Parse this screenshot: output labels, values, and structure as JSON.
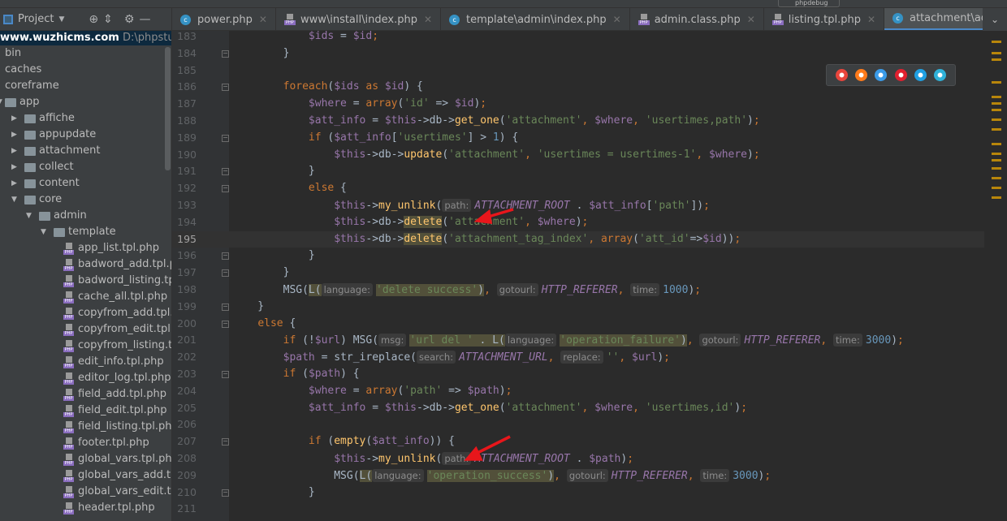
{
  "toolbar": {
    "run_config": "phpdebug"
  },
  "sidebar": {
    "title": "Project",
    "project_name": "www.wuzhicms.com",
    "project_path": "D:\\phpstudy_pro",
    "items": [
      {
        "label": "bin",
        "level": 0,
        "type": "folder",
        "arrow": ""
      },
      {
        "label": "caches",
        "level": 0,
        "type": "folder",
        "arrow": ""
      },
      {
        "label": "coreframe",
        "level": 0,
        "type": "folder",
        "arrow": ""
      },
      {
        "label": "app",
        "level": 0,
        "type": "folder",
        "arrow": "open"
      },
      {
        "label": "affiche",
        "level": 1,
        "type": "folder",
        "arrow": "closed"
      },
      {
        "label": "appupdate",
        "level": 1,
        "type": "folder",
        "arrow": "closed"
      },
      {
        "label": "attachment",
        "level": 1,
        "type": "folder",
        "arrow": "closed"
      },
      {
        "label": "collect",
        "level": 1,
        "type": "folder",
        "arrow": "closed"
      },
      {
        "label": "content",
        "level": 1,
        "type": "folder",
        "arrow": "closed"
      },
      {
        "label": "core",
        "level": 1,
        "type": "folder",
        "arrow": "open"
      },
      {
        "label": "admin",
        "level": 2,
        "type": "folder",
        "arrow": "open"
      },
      {
        "label": "template",
        "level": 3,
        "type": "folder",
        "arrow": "open"
      },
      {
        "label": "app_list.tpl.php",
        "level": 4,
        "type": "file"
      },
      {
        "label": "badword_add.tpl.php",
        "level": 4,
        "type": "file"
      },
      {
        "label": "badword_listing.tpl.php",
        "level": 4,
        "type": "file"
      },
      {
        "label": "cache_all.tpl.php",
        "level": 4,
        "type": "file"
      },
      {
        "label": "copyfrom_add.tpl.php",
        "level": 4,
        "type": "file"
      },
      {
        "label": "copyfrom_edit.tpl.php",
        "level": 4,
        "type": "file"
      },
      {
        "label": "copyfrom_listing.tpl.php",
        "level": 4,
        "type": "file"
      },
      {
        "label": "edit_info.tpl.php",
        "level": 4,
        "type": "file"
      },
      {
        "label": "editor_log.tpl.php",
        "level": 4,
        "type": "file"
      },
      {
        "label": "field_add.tpl.php",
        "level": 4,
        "type": "file"
      },
      {
        "label": "field_edit.tpl.php",
        "level": 4,
        "type": "file"
      },
      {
        "label": "field_listing.tpl.php",
        "level": 4,
        "type": "file"
      },
      {
        "label": "footer.tpl.php",
        "level": 4,
        "type": "file"
      },
      {
        "label": "global_vars.tpl.php",
        "level": 4,
        "type": "file"
      },
      {
        "label": "global_vars_add.tpl.php",
        "level": 4,
        "type": "file"
      },
      {
        "label": "global_vars_edit.tpl.php",
        "level": 4,
        "type": "file"
      },
      {
        "label": "header.tpl.php",
        "level": 4,
        "type": "file"
      }
    ]
  },
  "tabs": [
    {
      "label": "power.php",
      "icon": "class",
      "active": false
    },
    {
      "label": "www\\install\\index.php",
      "icon": "php",
      "active": false
    },
    {
      "label": "template\\admin\\index.php",
      "icon": "class",
      "active": false
    },
    {
      "label": "admin.class.php",
      "icon": "php",
      "active": false
    },
    {
      "label": "listing.tpl.php",
      "icon": "php",
      "active": false
    },
    {
      "label": "attachment\\admin\\index.php",
      "icon": "class",
      "active": true
    }
  ],
  "browsers": [
    {
      "name": "chrome",
      "color": "#e8453c"
    },
    {
      "name": "firefox",
      "color": "#ff7a1a"
    },
    {
      "name": "safari",
      "color": "#3a9be8"
    },
    {
      "name": "opera",
      "color": "#e0202f"
    },
    {
      "name": "ie",
      "color": "#1fa0e3"
    },
    {
      "name": "edge",
      "color": "#2fb1d8"
    }
  ],
  "editor": {
    "current_line": 195,
    "lines": [
      {
        "n": 183,
        "t": [
          [
            "d",
            "            "
          ],
          [
            "v",
            "$ids"
          ],
          [
            "d",
            " = "
          ],
          [
            "v",
            "$id"
          ],
          [
            "k",
            ";"
          ]
        ]
      },
      {
        "n": 184,
        "fold": true,
        "t": [
          [
            "d",
            "        }"
          ]
        ]
      },
      {
        "n": 185,
        "t": []
      },
      {
        "n": 186,
        "fold": true,
        "t": [
          [
            "d",
            "        "
          ],
          [
            "k",
            "foreach"
          ],
          [
            "d",
            "("
          ],
          [
            "v",
            "$ids"
          ],
          [
            "k",
            " as "
          ],
          [
            "v",
            "$id"
          ],
          [
            "d",
            ") {"
          ]
        ]
      },
      {
        "n": 187,
        "t": [
          [
            "d",
            "            "
          ],
          [
            "v",
            "$where"
          ],
          [
            "d",
            " = "
          ],
          [
            "k",
            "array"
          ],
          [
            "d",
            "("
          ],
          [
            "s",
            "'id'"
          ],
          [
            "d",
            " => "
          ],
          [
            "v",
            "$id"
          ],
          [
            "d",
            ")"
          ],
          [
            "k",
            ";"
          ]
        ]
      },
      {
        "n": 188,
        "t": [
          [
            "d",
            "            "
          ],
          [
            "v",
            "$att_info"
          ],
          [
            "d",
            " = "
          ],
          [
            "v",
            "$this"
          ],
          [
            "d",
            "->db->"
          ],
          [
            "f",
            "get_one"
          ],
          [
            "d",
            "("
          ],
          [
            "s",
            "'attachment'"
          ],
          [
            "k",
            ", "
          ],
          [
            "v",
            "$where"
          ],
          [
            "k",
            ", "
          ],
          [
            "s",
            "'usertimes,path'"
          ],
          [
            "d",
            ")"
          ],
          [
            "k",
            ";"
          ]
        ]
      },
      {
        "n": 189,
        "fold": true,
        "t": [
          [
            "d",
            "            "
          ],
          [
            "k",
            "if"
          ],
          [
            "d",
            " ("
          ],
          [
            "v",
            "$att_info"
          ],
          [
            "d",
            "["
          ],
          [
            "s",
            "'usertimes'"
          ],
          [
            "d",
            "] > "
          ],
          [
            "n",
            "1"
          ],
          [
            "d",
            ") {"
          ]
        ]
      },
      {
        "n": 190,
        "t": [
          [
            "d",
            "                "
          ],
          [
            "v",
            "$this"
          ],
          [
            "d",
            "->db->"
          ],
          [
            "f",
            "update"
          ],
          [
            "d",
            "("
          ],
          [
            "s",
            "'attachment'"
          ],
          [
            "k",
            ", "
          ],
          [
            "s",
            "'usertimes = usertimes-1'"
          ],
          [
            "k",
            ", "
          ],
          [
            "v",
            "$where"
          ],
          [
            "d",
            ")"
          ],
          [
            "k",
            ";"
          ]
        ]
      },
      {
        "n": 191,
        "fold": true,
        "t": [
          [
            "d",
            "            }"
          ]
        ]
      },
      {
        "n": 192,
        "fold": true,
        "t": [
          [
            "d",
            "            "
          ],
          [
            "k",
            "else"
          ],
          [
            "d",
            " {"
          ]
        ]
      },
      {
        "n": 193,
        "t": [
          [
            "d",
            "                "
          ],
          [
            "v",
            "$this"
          ],
          [
            "d",
            "->"
          ],
          [
            "f",
            "my_unlink"
          ],
          [
            "d",
            "("
          ],
          [
            "h",
            "path:"
          ],
          [
            "c",
            "ATTACHMENT_ROOT"
          ],
          [
            "d",
            " . "
          ],
          [
            "v",
            "$att_info"
          ],
          [
            "d",
            "["
          ],
          [
            "s",
            "'path'"
          ],
          [
            "d",
            "])"
          ],
          [
            "k",
            ";"
          ]
        ]
      },
      {
        "n": 194,
        "t": [
          [
            "d",
            "                "
          ],
          [
            "v",
            "$this"
          ],
          [
            "d",
            "->db->"
          ],
          [
            "f hl",
            "delete"
          ],
          [
            "d",
            "("
          ],
          [
            "s",
            "'attachment'"
          ],
          [
            "k",
            ", "
          ],
          [
            "v",
            "$where"
          ],
          [
            "d",
            ")"
          ],
          [
            "k",
            ";"
          ]
        ]
      },
      {
        "n": 195,
        "t": [
          [
            "d",
            "                "
          ],
          [
            "v",
            "$this"
          ],
          [
            "d",
            "->db->"
          ],
          [
            "f hl",
            "delete"
          ],
          [
            "d",
            "("
          ],
          [
            "s",
            "'attachment_tag_index'"
          ],
          [
            "k",
            ", "
          ],
          [
            "k",
            "array"
          ],
          [
            "d",
            "("
          ],
          [
            "s",
            "'att_id'"
          ],
          [
            "d",
            "=>"
          ],
          [
            "v",
            "$id"
          ],
          [
            "d",
            "))"
          ],
          [
            "k",
            ";"
          ]
        ]
      },
      {
        "n": 196,
        "fold": true,
        "t": [
          [
            "d",
            "            }"
          ]
        ]
      },
      {
        "n": 197,
        "fold": true,
        "t": [
          [
            "d",
            "        }"
          ]
        ]
      },
      {
        "n": 198,
        "t": [
          [
            "d",
            "        MSG("
          ],
          [
            "d hl",
            "L("
          ],
          [
            "h",
            "language:"
          ],
          [
            "s hl",
            "'delete success'"
          ],
          [
            "d hl",
            ")"
          ],
          [
            "k",
            ", "
          ],
          [
            "h",
            "gotourl:"
          ],
          [
            "c",
            "HTTP_REFERER"
          ],
          [
            "k",
            ", "
          ],
          [
            "h",
            "time:"
          ],
          [
            "n",
            "1000"
          ],
          [
            "d",
            ")"
          ],
          [
            "k",
            ";"
          ]
        ]
      },
      {
        "n": 199,
        "fold": true,
        "t": [
          [
            "d",
            "    }"
          ]
        ]
      },
      {
        "n": 200,
        "fold": true,
        "t": [
          [
            "d",
            "    "
          ],
          [
            "k",
            "else"
          ],
          [
            "d",
            " {"
          ]
        ]
      },
      {
        "n": 201,
        "t": [
          [
            "d",
            "        "
          ],
          [
            "k",
            "if"
          ],
          [
            "d",
            " (!"
          ],
          [
            "v",
            "$url"
          ],
          [
            "d",
            ") MSG("
          ],
          [
            "h",
            "msg:"
          ],
          [
            "s hl",
            "'url del '"
          ],
          [
            "d hl",
            " . "
          ],
          [
            "d hl",
            "L("
          ],
          [
            "h",
            "language:"
          ],
          [
            "s hl",
            "'operation_failure'"
          ],
          [
            "d hl",
            ")"
          ],
          [
            "k",
            ", "
          ],
          [
            "h",
            "gotourl:"
          ],
          [
            "c",
            "HTTP_REFERER"
          ],
          [
            "k",
            ", "
          ],
          [
            "h",
            "time:"
          ],
          [
            "n",
            "3000"
          ],
          [
            "d",
            ")"
          ],
          [
            "k",
            ";"
          ]
        ]
      },
      {
        "n": 202,
        "t": [
          [
            "d",
            "        "
          ],
          [
            "v",
            "$path"
          ],
          [
            "d",
            " = str_ireplace("
          ],
          [
            "h",
            "search:"
          ],
          [
            "c",
            "ATTACHMENT_URL"
          ],
          [
            "k",
            ", "
          ],
          [
            "h",
            "replace:"
          ],
          [
            "s",
            "''"
          ],
          [
            "k",
            ", "
          ],
          [
            "v",
            "$url"
          ],
          [
            "d",
            ")"
          ],
          [
            "k",
            ";"
          ]
        ]
      },
      {
        "n": 203,
        "fold": true,
        "t": [
          [
            "d",
            "        "
          ],
          [
            "k",
            "if"
          ],
          [
            "d",
            " ("
          ],
          [
            "v",
            "$path"
          ],
          [
            "d",
            ") {"
          ]
        ]
      },
      {
        "n": 204,
        "t": [
          [
            "d",
            "            "
          ],
          [
            "v",
            "$where"
          ],
          [
            "d",
            " = "
          ],
          [
            "k",
            "array"
          ],
          [
            "d",
            "("
          ],
          [
            "s",
            "'path'"
          ],
          [
            "d",
            " => "
          ],
          [
            "v",
            "$path"
          ],
          [
            "d",
            ")"
          ],
          [
            "k",
            ";"
          ]
        ]
      },
      {
        "n": 205,
        "t": [
          [
            "d",
            "            "
          ],
          [
            "v",
            "$att_info"
          ],
          [
            "d",
            " = "
          ],
          [
            "v",
            "$this"
          ],
          [
            "d",
            "->db->"
          ],
          [
            "f",
            "get_one"
          ],
          [
            "d",
            "("
          ],
          [
            "s",
            "'attachment'"
          ],
          [
            "k",
            ", "
          ],
          [
            "v",
            "$where"
          ],
          [
            "k",
            ", "
          ],
          [
            "s",
            "'usertimes,id'"
          ],
          [
            "d",
            ")"
          ],
          [
            "k",
            ";"
          ]
        ]
      },
      {
        "n": 206,
        "t": []
      },
      {
        "n": 207,
        "fold": true,
        "t": [
          [
            "d",
            "            "
          ],
          [
            "k",
            "if"
          ],
          [
            "d",
            " ("
          ],
          [
            "f",
            "empty"
          ],
          [
            "d",
            "("
          ],
          [
            "v",
            "$att_info"
          ],
          [
            "d",
            ")) {"
          ]
        ]
      },
      {
        "n": 208,
        "t": [
          [
            "d",
            "                "
          ],
          [
            "v",
            "$this"
          ],
          [
            "d",
            "->"
          ],
          [
            "f",
            "my_unlink"
          ],
          [
            "d",
            "("
          ],
          [
            "h",
            "path:"
          ],
          [
            "c",
            "ATTACHMENT_ROOT"
          ],
          [
            "d",
            " . "
          ],
          [
            "v",
            "$path"
          ],
          [
            "d",
            ")"
          ],
          [
            "k",
            ";"
          ]
        ]
      },
      {
        "n": 209,
        "t": [
          [
            "d",
            "                MSG("
          ],
          [
            "d hl",
            "L("
          ],
          [
            "h",
            "language:"
          ],
          [
            "s hl",
            "'operation_success'"
          ],
          [
            "d hl",
            ")"
          ],
          [
            "k",
            ", "
          ],
          [
            "h",
            "gotourl:"
          ],
          [
            "c",
            "HTTP_REFERER"
          ],
          [
            "k",
            ", "
          ],
          [
            "h",
            "time:"
          ],
          [
            "n",
            "3000"
          ],
          [
            "d",
            ")"
          ],
          [
            "k",
            ";"
          ]
        ]
      },
      {
        "n": 210,
        "fold": true,
        "t": [
          [
            "d",
            "            }"
          ]
        ]
      },
      {
        "n": 211,
        "t": []
      }
    ]
  }
}
